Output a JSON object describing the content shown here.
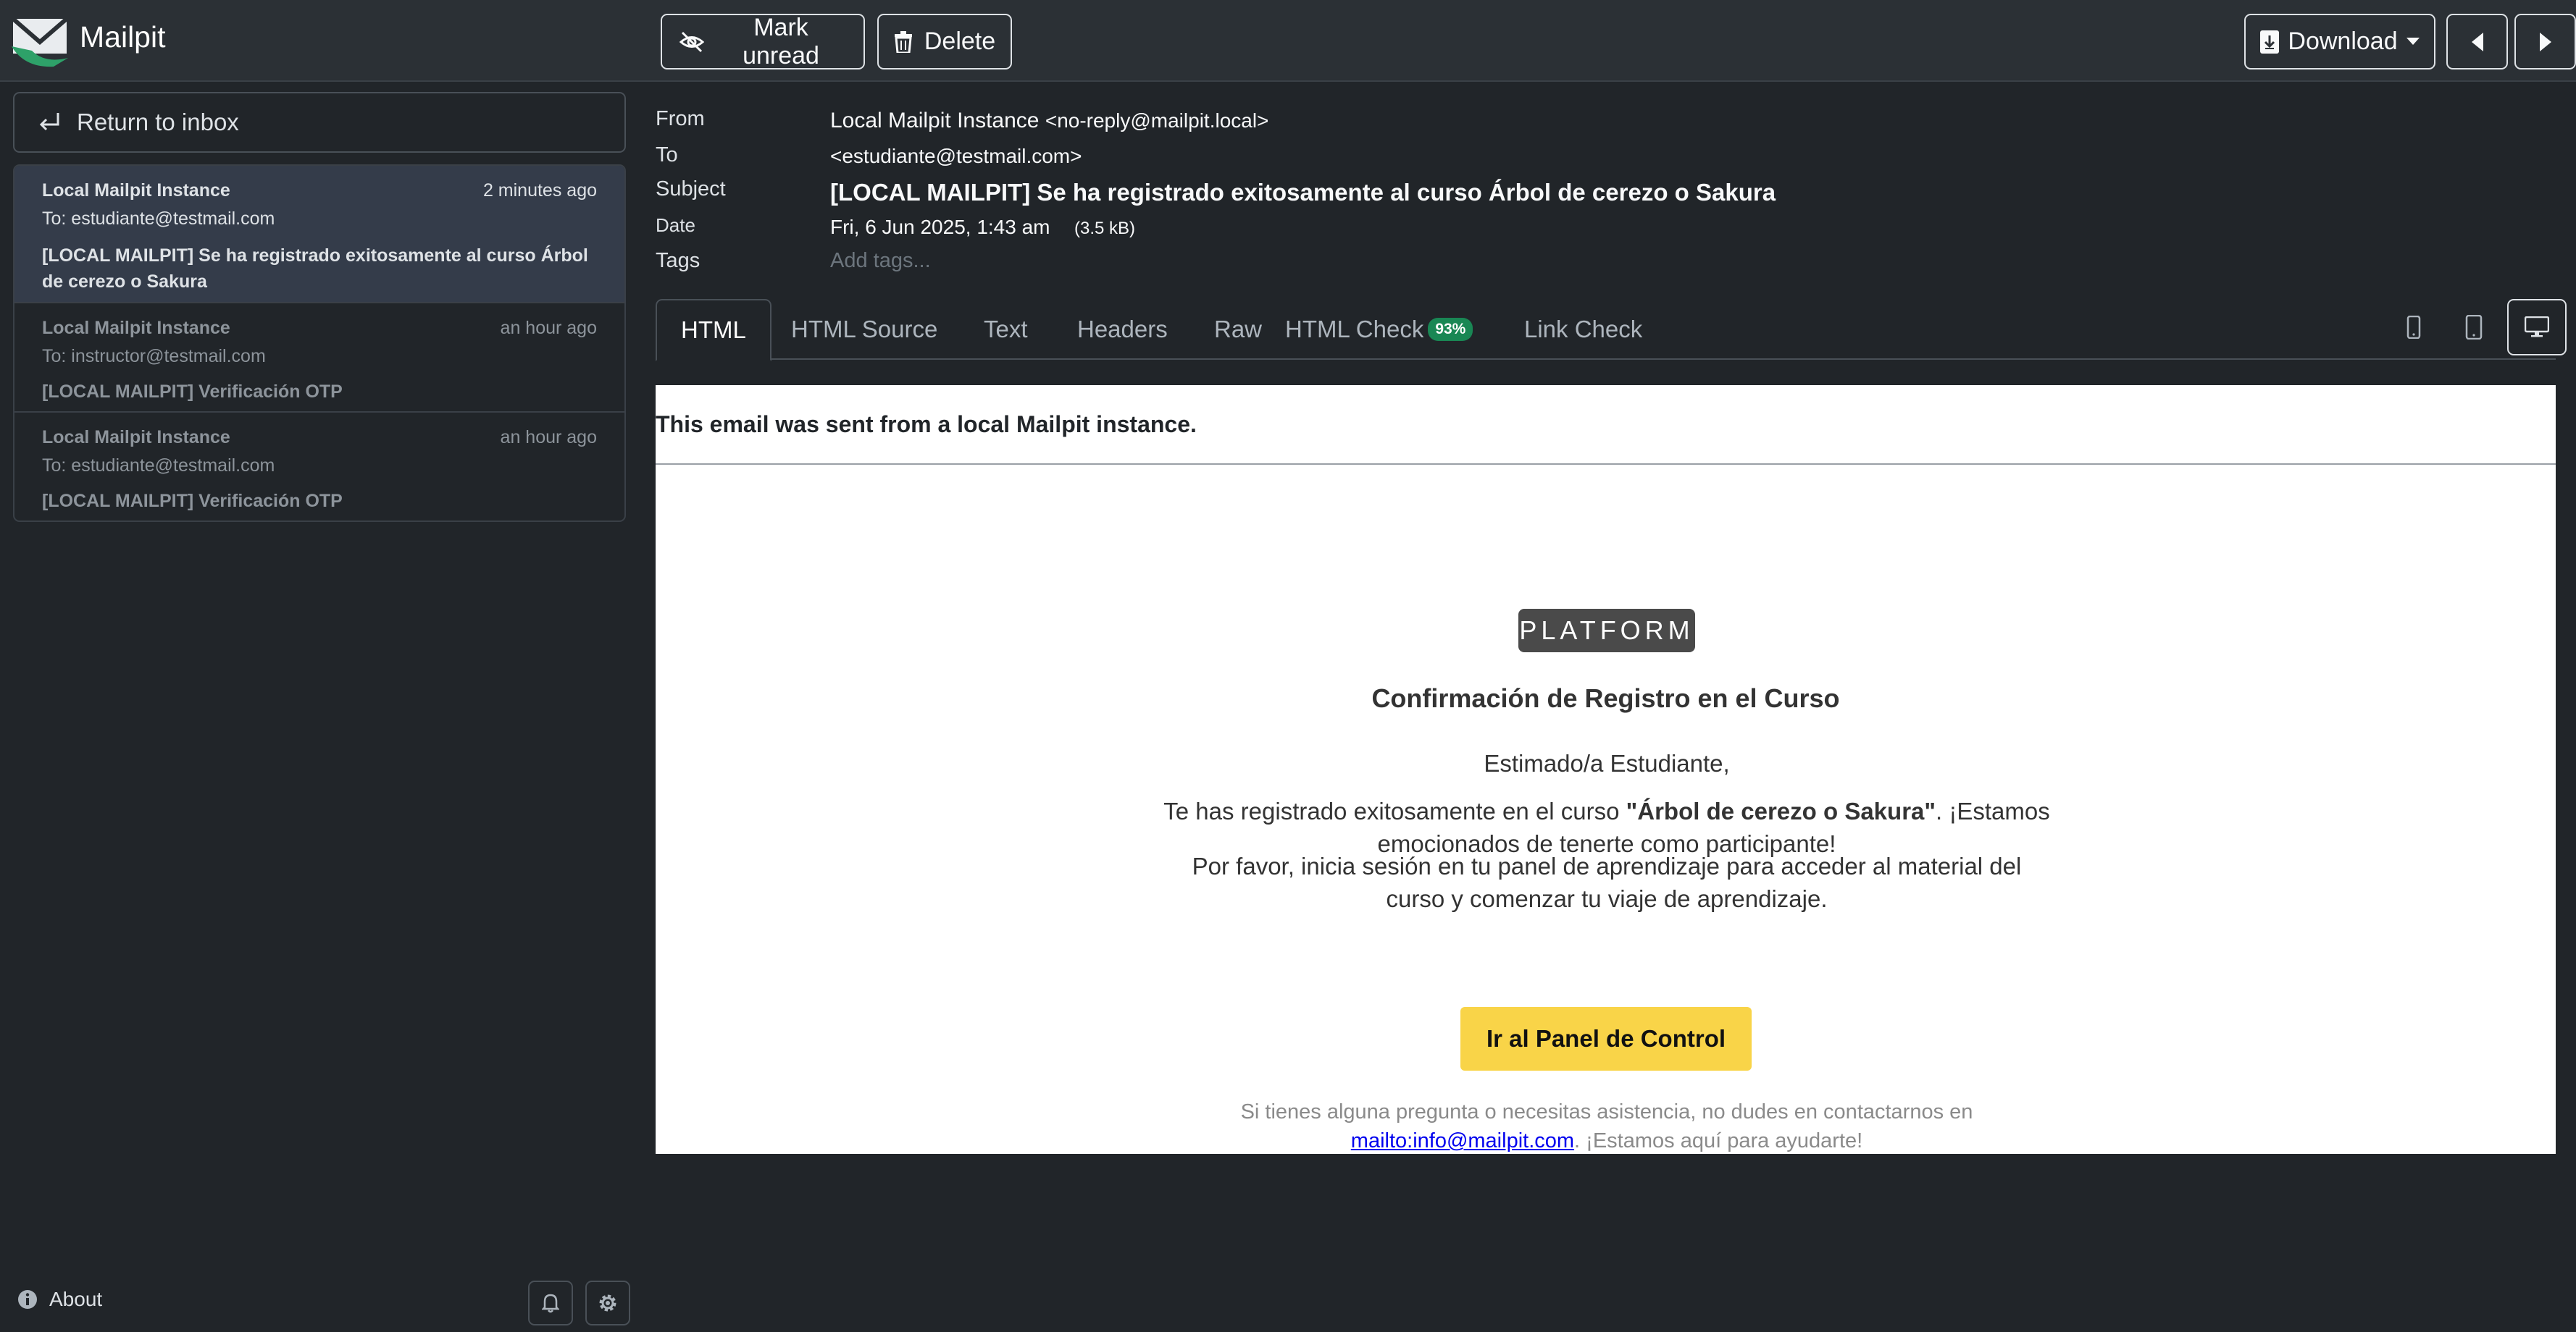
{
  "app": {
    "name": "Mailpit"
  },
  "toolbar": {
    "mark_unread": "Mark unread",
    "delete": "Delete",
    "download": "Download"
  },
  "sidebar": {
    "return_label": "Return to inbox",
    "messages": [
      {
        "from": "Local Mailpit Instance",
        "time": "2 minutes ago",
        "to": "To: estudiante@testmail.com",
        "subject": "[LOCAL MAILPIT] Se ha registrado exitosamente al curso Árbol de cerezo o Sakura",
        "active": true
      },
      {
        "from": "Local Mailpit Instance",
        "time": "an hour ago",
        "to": "To: instructor@testmail.com",
        "subject": "[LOCAL MAILPIT] Verificación OTP",
        "active": false
      },
      {
        "from": "Local Mailpit Instance",
        "time": "an hour ago",
        "to": "To: estudiante@testmail.com",
        "subject": "[LOCAL MAILPIT] Verificación OTP",
        "active": false
      }
    ],
    "about_label": "About"
  },
  "headers": {
    "from_label": "From",
    "from_name": "Local Mailpit Instance",
    "from_addr": "<no-reply@mailpit.local>",
    "to_label": "To",
    "to_value": "<estudiante@testmail.com>",
    "subject_label": "Subject",
    "subject_value": "[LOCAL MAILPIT] Se ha registrado exitosamente al curso Árbol de cerezo o  Sakura",
    "date_label": "Date",
    "date_value": "Fri, 6 Jun 2025, 1:43 am",
    "size_value": "(3.5 kB)",
    "tags_label": "Tags",
    "tags_placeholder": "Add tags..."
  },
  "tabs": {
    "html": "HTML",
    "html_source": "HTML Source",
    "text": "Text",
    "headers": "Headers",
    "raw": "Raw",
    "html_check": "HTML Check",
    "html_check_badge": "93%",
    "link_check": "Link Check"
  },
  "email": {
    "notice": "This email was sent from a local Mailpit instance.",
    "logo_text": "PLATFORM",
    "title": "Confirmación de Registro en el Curso",
    "greeting": "Estimado/a Estudiante,",
    "para1_before": "Te has registrado exitosamente en el curso ",
    "para1_course": "\"Árbol de cerezo o Sakura\"",
    "para1_after": ". ¡Estamos emocionados de tenerte como participante!",
    "para2": "Por favor, inicia sesión en tu panel de aprendizaje para acceder al material del curso y comenzar tu viaje de aprendizaje.",
    "cta": "Ir al Panel de Control",
    "footer_before": "Si tienes alguna pregunta o necesitas asistencia, no dudes en contactarnos en ",
    "footer_link": "mailto:info@mailpit.com",
    "footer_after": ". ¡Estamos aquí para ayudarte!"
  },
  "colors": {
    "background": "#212529",
    "topbar": "#2b3035",
    "active_item": "#343c4a",
    "badge": "#198754",
    "cta": "#f9d448",
    "logo_green": "#2ea169"
  }
}
